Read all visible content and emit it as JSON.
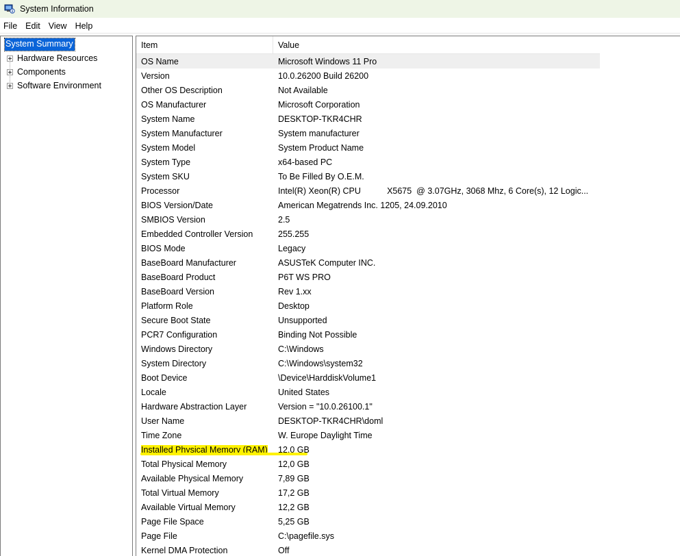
{
  "window": {
    "title": "System Information",
    "app_icon": "system-information-icon"
  },
  "menu": [
    "File",
    "Edit",
    "View",
    "Help"
  ],
  "tree": {
    "root": "System Summary",
    "children": [
      "Hardware Resources",
      "Components",
      "Software Environment"
    ]
  },
  "table": {
    "columns": [
      "Item",
      "Value"
    ],
    "rows": [
      {
        "item": "OS Name",
        "value": "Microsoft Windows 11 Pro"
      },
      {
        "item": "Version",
        "value": "10.0.26200 Build 26200"
      },
      {
        "item": "Other OS Description",
        "value": "Not Available"
      },
      {
        "item": "OS Manufacturer",
        "value": "Microsoft Corporation"
      },
      {
        "item": "System Name",
        "value": "DESKTOP-TKR4CHR"
      },
      {
        "item": "System Manufacturer",
        "value": "System manufacturer"
      },
      {
        "item": "System Model",
        "value": "System Product Name"
      },
      {
        "item": "System Type",
        "value": "x64-based PC"
      },
      {
        "item": "System SKU",
        "value": "To Be Filled By O.E.M."
      },
      {
        "item": "Processor",
        "value": "Intel(R) Xeon(R) CPU           X5675  @ 3.07GHz, 3068 Mhz, 6 Core(s), 12 Logic..."
      },
      {
        "item": "BIOS Version/Date",
        "value": "American Megatrends Inc. 1205, 24.09.2010"
      },
      {
        "item": "SMBIOS Version",
        "value": "2.5"
      },
      {
        "item": "Embedded Controller Version",
        "value": "255.255"
      },
      {
        "item": "BIOS Mode",
        "value": "Legacy"
      },
      {
        "item": "BaseBoard Manufacturer",
        "value": "ASUSTeK Computer INC."
      },
      {
        "item": "BaseBoard Product",
        "value": "P6T WS PRO"
      },
      {
        "item": "BaseBoard Version",
        "value": "Rev 1.xx"
      },
      {
        "item": "Platform Role",
        "value": "Desktop"
      },
      {
        "item": "Secure Boot State",
        "value": "Unsupported"
      },
      {
        "item": "PCR7 Configuration",
        "value": "Binding Not Possible"
      },
      {
        "item": "Windows Directory",
        "value": "C:\\Windows"
      },
      {
        "item": "System Directory",
        "value": "C:\\Windows\\system32"
      },
      {
        "item": "Boot Device",
        "value": "\\Device\\HarddiskVolume1"
      },
      {
        "item": "Locale",
        "value": "United States"
      },
      {
        "item": "Hardware Abstraction Layer",
        "value": "Version = \"10.0.26100.1\""
      },
      {
        "item": "User Name",
        "value": "DESKTOP-TKR4CHR\\doml"
      },
      {
        "item": "Time Zone",
        "value": "W. Europe Daylight Time"
      },
      {
        "item": "Installed Physical Memory (RAM)",
        "value": "12,0 GB"
      },
      {
        "item": "Total Physical Memory",
        "value": "12,0 GB"
      },
      {
        "item": "Available Physical Memory",
        "value": "7,89 GB"
      },
      {
        "item": "Total Virtual Memory",
        "value": "17,2 GB"
      },
      {
        "item": "Available Virtual Memory",
        "value": "12,2 GB"
      },
      {
        "item": "Page File Space",
        "value": "5,25 GB"
      },
      {
        "item": "Page File",
        "value": "C:\\pagefile.sys"
      },
      {
        "item": "Kernel DMA Protection",
        "value": "Off"
      }
    ]
  },
  "colors": {
    "titlebar_bg": "#eef5e6",
    "selection_bg": "#0a64d8",
    "highlight": "#fff200"
  }
}
